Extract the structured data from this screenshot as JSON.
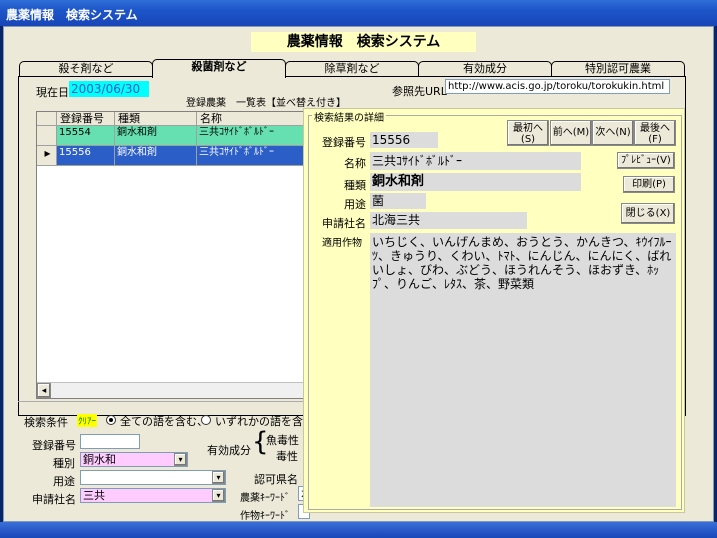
{
  "window": {
    "title": "農薬情報　検索システム"
  },
  "app_header": "農薬情報　検索システム",
  "tabs": [
    {
      "label": "殺そ剤など"
    },
    {
      "label": "殺菌剤など"
    },
    {
      "label": "除草剤など"
    },
    {
      "label": "有効成分"
    },
    {
      "label": "特別認可農業"
    }
  ],
  "current_date": {
    "label": "現在日",
    "value": "2003/06/30"
  },
  "reference_url": {
    "label": "参照先URL",
    "value": "http://www.acis.go.jp/toroku/torokukin.html"
  },
  "grid": {
    "title": "登録農薬　一覧表【並べ替え付き】",
    "columns": [
      "登録番号",
      "種類",
      "名称"
    ],
    "rows": [
      {
        "reg_no": "15554",
        "type": "銅水和剤",
        "name": "三共ｺｻｲﾄﾞﾎﾞﾙﾄﾞｰ"
      },
      {
        "reg_no": "15556",
        "type": "銅水和剤",
        "name": "三共ｺｻｲﾄﾞﾎﾞﾙﾄﾞｰ"
      }
    ],
    "row_marker": "▸"
  },
  "detail": {
    "group_title": "検索結果の詳細",
    "labels": {
      "reg_no": "登録番号",
      "name": "名称",
      "type": "種類",
      "use": "用途",
      "applicant": "申請社名",
      "crops": "適用作物"
    },
    "values": {
      "reg_no": "15556",
      "name": "三共ｺｻｲﾄﾞﾎﾞﾙﾄﾞｰ",
      "type": "銅水和剤",
      "use": "菌",
      "applicant": "北海三共",
      "crops": "いちじく、いんげんまめ、おうとう、かんきつ、ｷｳｲﾌﾙｰﾂ、きゅうり、くわい、ﾄﾏﾄ、にんじん、にんにく、ばれいしょ、びわ、ぶどう、ほうれんそう、ほおずき、ﾎｯﾌﾟ、りんご、ﾚﾀｽ、茶、野菜類"
    },
    "buttons": {
      "first_line1": "最初へ",
      "first_line2": "(S)",
      "prev": "前へ(M)",
      "next": "次へ(N)",
      "last_line1": "最後へ",
      "last_line2": "(F)",
      "preview": "ﾌﾟﾚﾋﾞｭｰ(V)",
      "print": "印刷(P)",
      "close": "閉じる(X)"
    }
  },
  "search": {
    "group_label": "検索条件",
    "clear_label": "ｸﾘｱｰ",
    "radio_all": "全ての語を含む、",
    "radio_any": "いずれかの語を含む",
    "reg_no_label": "登録番号",
    "reg_no_value": "",
    "type_label": "種別",
    "type_value": "銅水和",
    "use_label": "用途",
    "use_value": "",
    "applicant_label": "申請社名",
    "applicant_value": "三共",
    "ingredient_label": "有効成分",
    "fish_toxicity": "魚毒性",
    "toxicity": "毒性",
    "prefecture_label": "認可県名",
    "keyword_label": "農薬ｷｰﾜｰﾄﾞ",
    "keyword_value": "水",
    "crop_keyword_label": "作物ｷｰﾜｰﾄﾞ",
    "crop_keyword_value": ""
  },
  "colors": {
    "selected_row": "#2c5ec8",
    "alt_row": "#66e0b0",
    "highlight_field": "#ffccff",
    "date_field": "#00ffff",
    "popup_bg": "#ffffc0"
  }
}
